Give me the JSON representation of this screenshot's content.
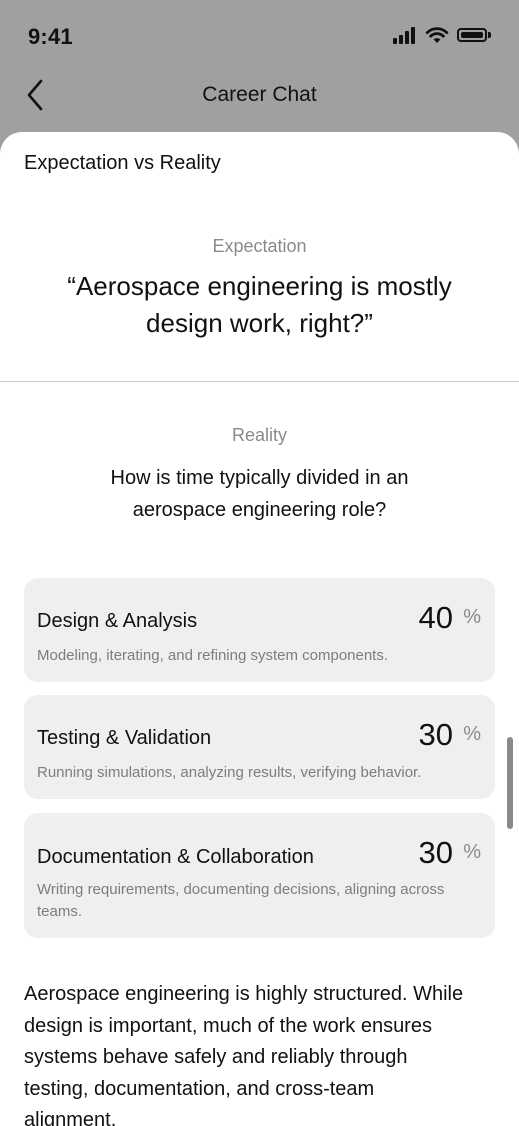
{
  "status_bar": {
    "time": "9:41"
  },
  "nav": {
    "title": "Career Chat"
  },
  "sheet": {
    "title": "Expectation vs Reality",
    "expectation": {
      "label": "Expectation",
      "quote": "“Aerospace engineering is mostly design work, right?”"
    },
    "reality": {
      "label": "Reality",
      "question": "How is time typically divided in an aerospace engineering role?"
    },
    "breakdown": [
      {
        "title": "Design & Analysis",
        "value": "40",
        "unit": "%",
        "description": "Modeling, iterating, and refining system components."
      },
      {
        "title": "Testing & Validation",
        "value": "30",
        "unit": "%",
        "description": "Running simulations, analyzing results, verifying behavior."
      },
      {
        "title": "Documentation & Collaboration",
        "value": "30",
        "unit": "%",
        "description": "Writing requirements, documenting decisions, aligning across teams."
      }
    ],
    "summary": "Aerospace engineering is highly structured. While design is important, much of the work ensures systems behave safely and reliably through testing, documentation, and cross-team alignment."
  }
}
